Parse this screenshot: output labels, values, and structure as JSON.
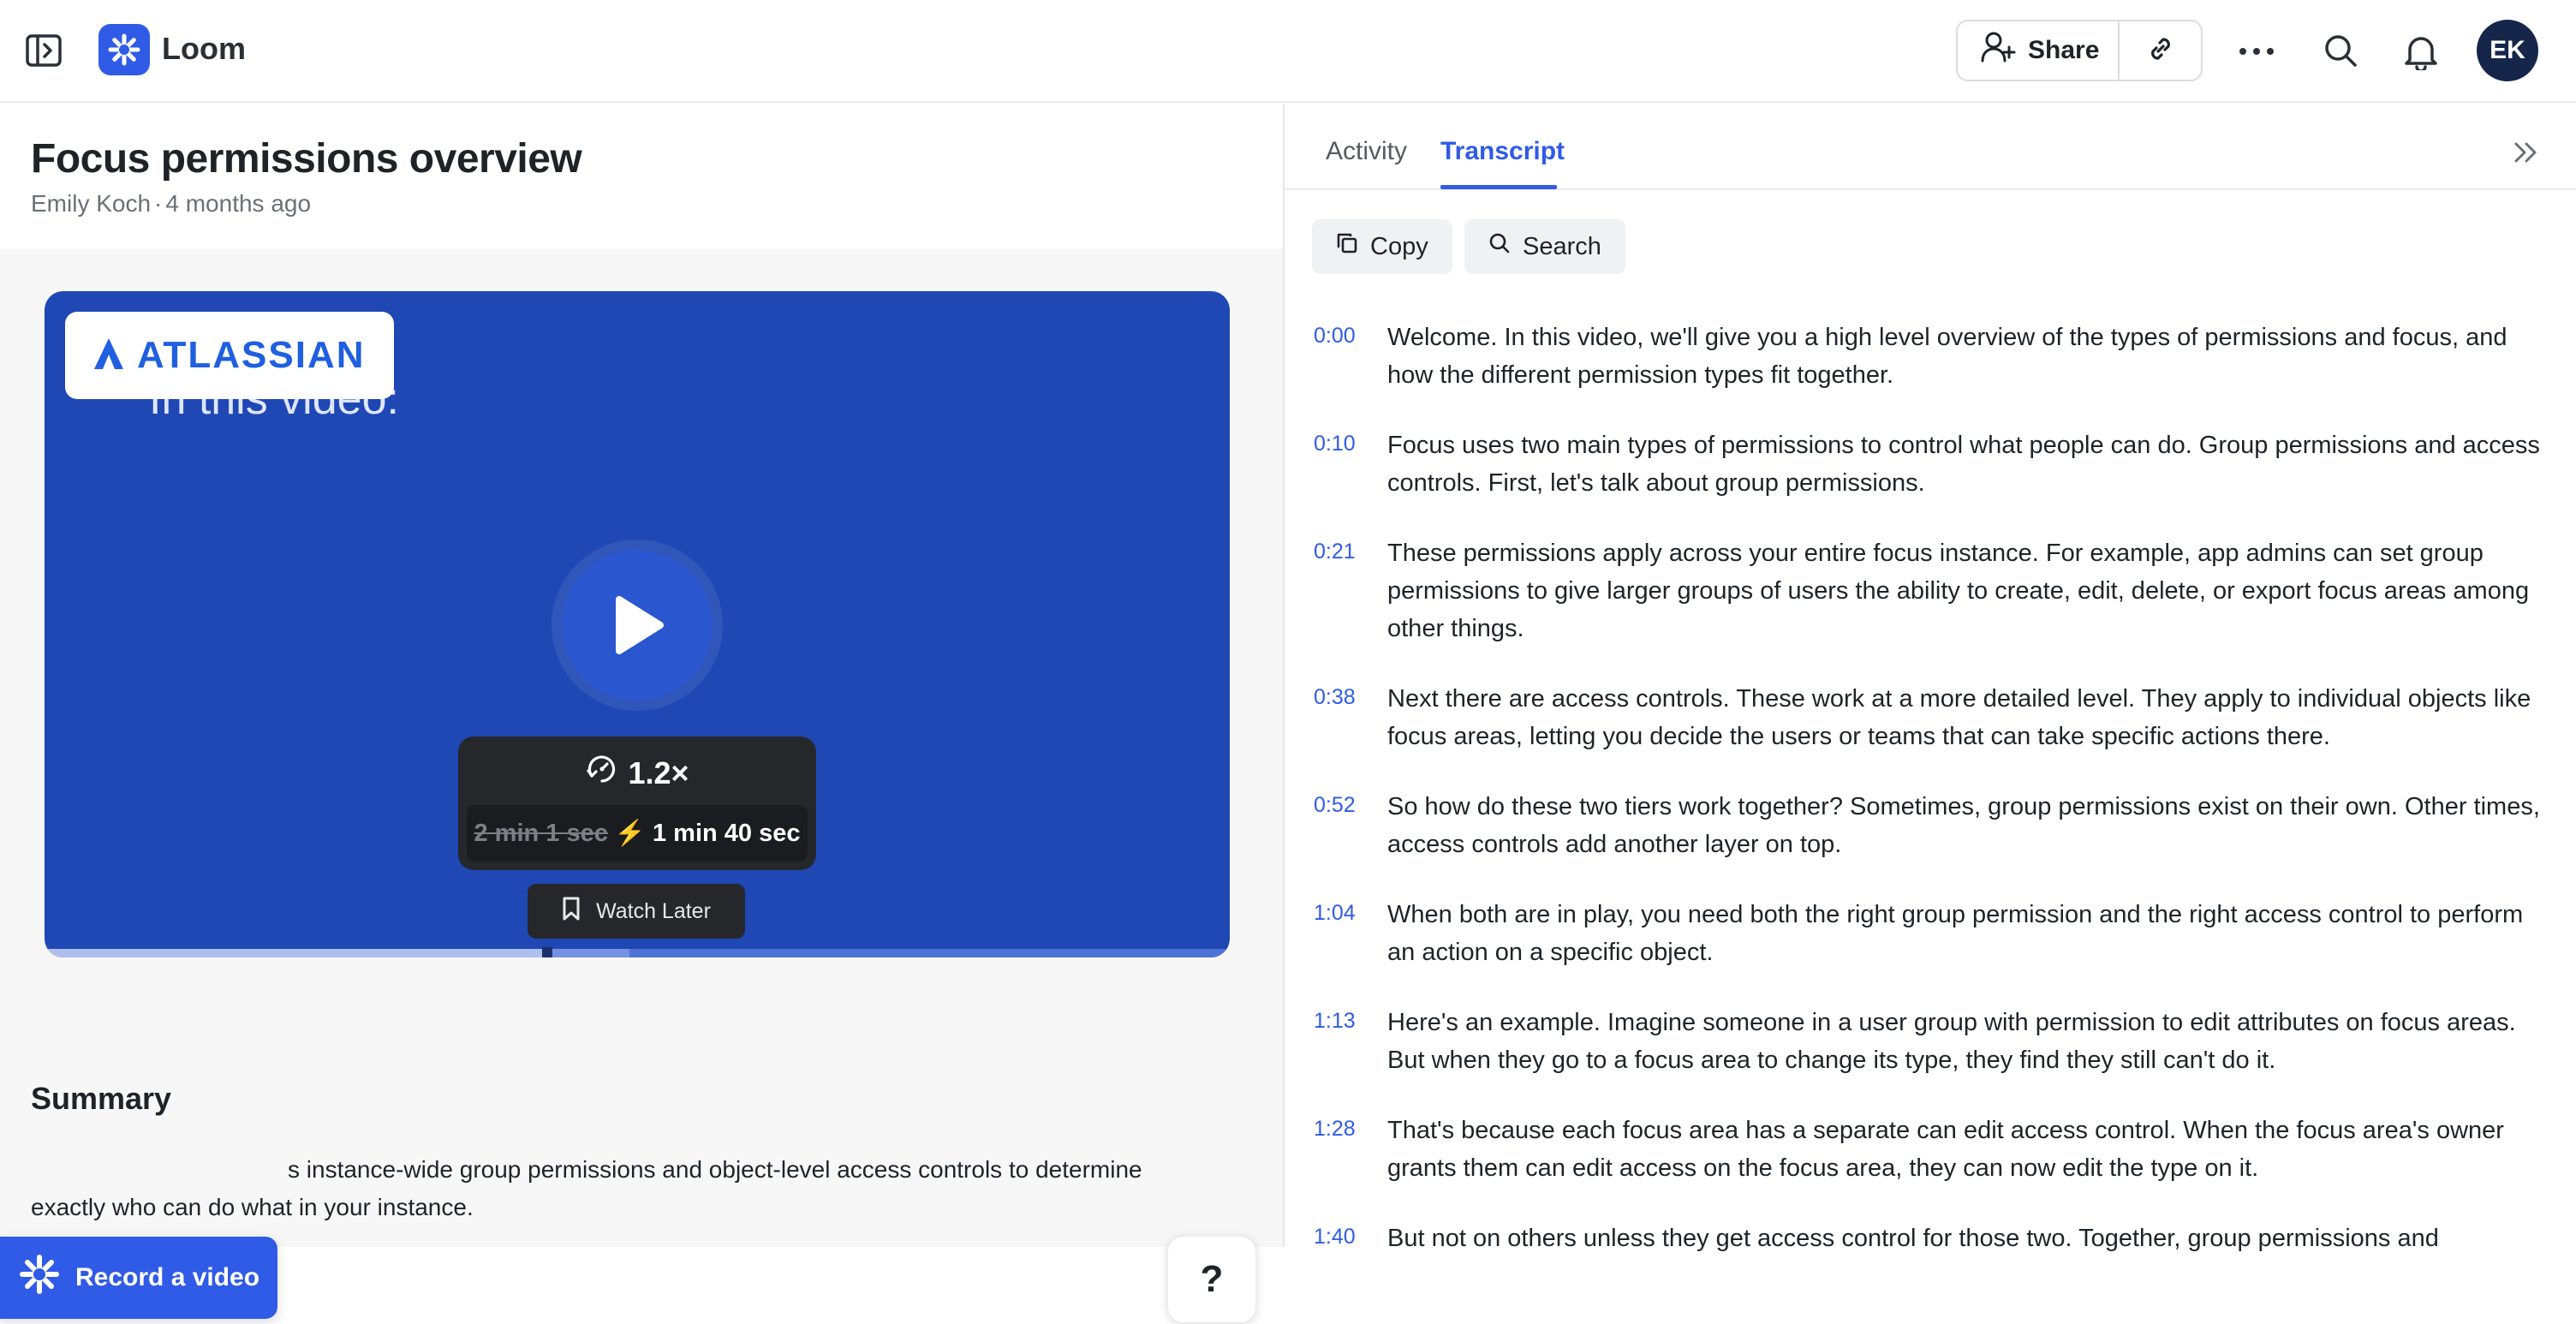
{
  "app": {
    "name": "Loom"
  },
  "topbar": {
    "share_label": "Share",
    "avatar_initials": "EK",
    "icons": [
      "sidebar-toggle-icon",
      "loom-logo-icon",
      "add-user-icon",
      "link-icon",
      "more-icon",
      "search-icon",
      "bell-icon"
    ]
  },
  "video": {
    "title": "Focus permissions overview",
    "author": "Emily Koch",
    "age": "4 months ago",
    "brand": "ATLASSIAN",
    "caption": "In this video:",
    "speed": "1.2×",
    "original_time": "2 min 1 sec",
    "new_time": "1 min 40 sec",
    "watch_later_label": "Watch Later",
    "progress": 0.42
  },
  "summary": {
    "title": "Summary",
    "text": "s instance-wide group permissions and object-level access controls to determine exactly who can do what in your instance."
  },
  "record_label": "Record a video",
  "help_label": "?",
  "panel": {
    "tabs": [
      "Activity",
      "Transcript"
    ],
    "active_tab": "Transcript",
    "copy_label": "Copy",
    "search_label": "Search"
  },
  "transcript": [
    {
      "time": "0:00",
      "text": "Welcome. In this video, we'll give you a high level overview of the types of permissions and focus, and how the different permission types fit together."
    },
    {
      "time": "0:10",
      "text": "Focus uses two main types of permissions to control what people can do. Group permissions and access controls. First, let's talk about group permissions."
    },
    {
      "time": "0:21",
      "text": "These permissions apply across your entire focus instance. For example, app admins can set group permissions to give larger groups of users the ability to create, edit, delete, or export focus areas among other things."
    },
    {
      "time": "0:38",
      "text": "Next there are access controls. These work at a more detailed level. They apply to individual objects like focus areas, letting you decide the users or teams that can take specific actions there."
    },
    {
      "time": "0:52",
      "text": "So how do these two tiers work together? Sometimes, group permissions exist on their own. Other times, access controls add another layer on top."
    },
    {
      "time": "1:04",
      "text": "When both are in play, you need both the right group permission and the right access control to perform an action on a specific object."
    },
    {
      "time": "1:13",
      "text": "Here's an example. Imagine someone in a user group with permission to edit attributes on focus areas. But when they go to a focus area to change its type, they find they still can't do it."
    },
    {
      "time": "1:28",
      "text": "That's because each focus area has a separate can edit access control. When the focus area's owner grants them can edit access on the focus area, they can now edit the type on it."
    },
    {
      "time": "1:40",
      "text": "But not on others unless they get access control for those two. Together, group permissions and"
    }
  ]
}
